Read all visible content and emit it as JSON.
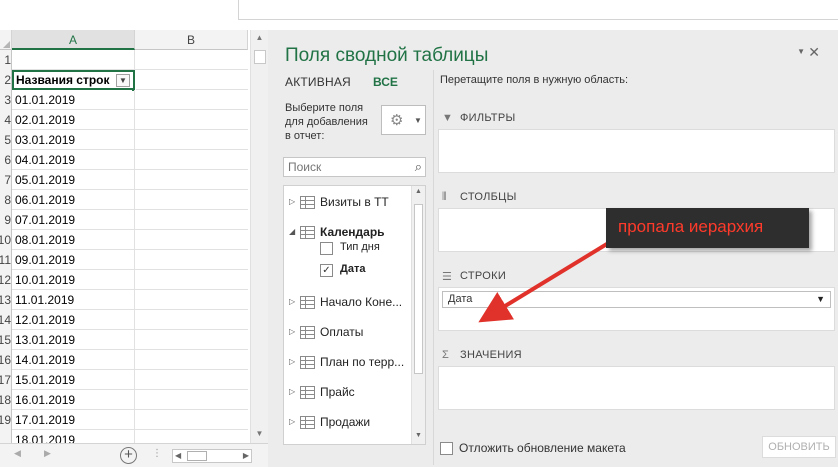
{
  "sheet": {
    "columns": [
      "A",
      "B"
    ],
    "row_numbers": [
      "1",
      "2",
      "3",
      "4",
      "5",
      "6",
      "7",
      "8",
      "9",
      "10",
      "11",
      "12",
      "13",
      "14",
      "15",
      "16",
      "17",
      "18",
      "19"
    ],
    "rows": [
      "",
      "Названия строк",
      "01.01.2019",
      "02.01.2019",
      "03.01.2019",
      "04.01.2019",
      "05.01.2019",
      "06.01.2019",
      "07.01.2019",
      "08.01.2019",
      "09.01.2019",
      "10.01.2019",
      "11.01.2019",
      "12.01.2019",
      "13.01.2019",
      "14.01.2019",
      "15.01.2019",
      "16.01.2019",
      "17.01.2019",
      "18.01.2019"
    ]
  },
  "pane": {
    "title": "Поля сводной таблицы",
    "tab_active": "АКТИВНАЯ",
    "tab_all": "ВСЕ",
    "choose_fields": "Выберите поля для добавления в отчет:",
    "search_placeholder": "Поиск",
    "fields": [
      {
        "name": "Визиты в ТТ"
      },
      {
        "name": "Календарь"
      },
      {
        "name": "Начало Коне..."
      },
      {
        "name": "Оплаты"
      },
      {
        "name": "План по терр..."
      },
      {
        "name": "Прайс"
      },
      {
        "name": "Продажи"
      }
    ],
    "calendar_children": [
      {
        "name": "Тип дня",
        "checked": false
      },
      {
        "name": "Дата",
        "checked": true
      }
    ],
    "drag_hint": "Перетащите поля в нужную область:",
    "areas": {
      "filters": "ФИЛЬТРЫ",
      "columns": "СТОЛБЦЫ",
      "rows": "СТРОКИ",
      "values": "ЗНАЧЕНИЯ"
    },
    "rows_field": "Дата",
    "defer_label": "Отложить обновление макета",
    "update_button": "ОБНОВИТЬ"
  },
  "annotation": {
    "text": "пропала иерархия"
  },
  "colors": {
    "accent": "#217346",
    "annotation_text": "#ff3a2a",
    "annotation_bg": "#2e2e2e",
    "arrow": "#e0322a"
  }
}
